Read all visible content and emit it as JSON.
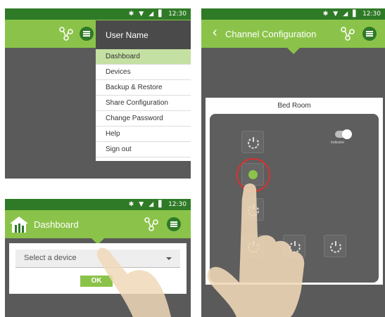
{
  "panel1": {
    "status": {
      "bt": "✱",
      "wifi": "▼",
      "signal": "◢",
      "battery": "▋",
      "time": "12:30"
    },
    "user_name": "User Name",
    "menu": [
      {
        "label": "Dashboard",
        "active": true
      },
      {
        "label": "Devices"
      },
      {
        "label": "Backup & Restore"
      },
      {
        "label": "Share Configuration"
      },
      {
        "label": "Change Password"
      },
      {
        "label": "Help"
      },
      {
        "label": "Sign out"
      }
    ]
  },
  "panel2": {
    "status": {
      "bt": "✱",
      "wifi": "▼",
      "signal": "◢",
      "battery": "▋",
      "time": "12:30"
    },
    "title": "Dashboard",
    "select_placeholder": "Select a device",
    "ok_label": "OK"
  },
  "panel3": {
    "status": {
      "bt": "✱",
      "wifi": "▼",
      "signal": "◢",
      "battery": "▋",
      "time": "12:30"
    },
    "back_icon": "‹",
    "title": "Channel Configuration",
    "room": "Bed Room",
    "indicator_label": "Indicator"
  },
  "colors": {
    "appbar": "#8bc34a",
    "statusbar": "#2f7a27",
    "drawer_active": "#c5e0a3",
    "highlight_ring": "#d8322f"
  }
}
